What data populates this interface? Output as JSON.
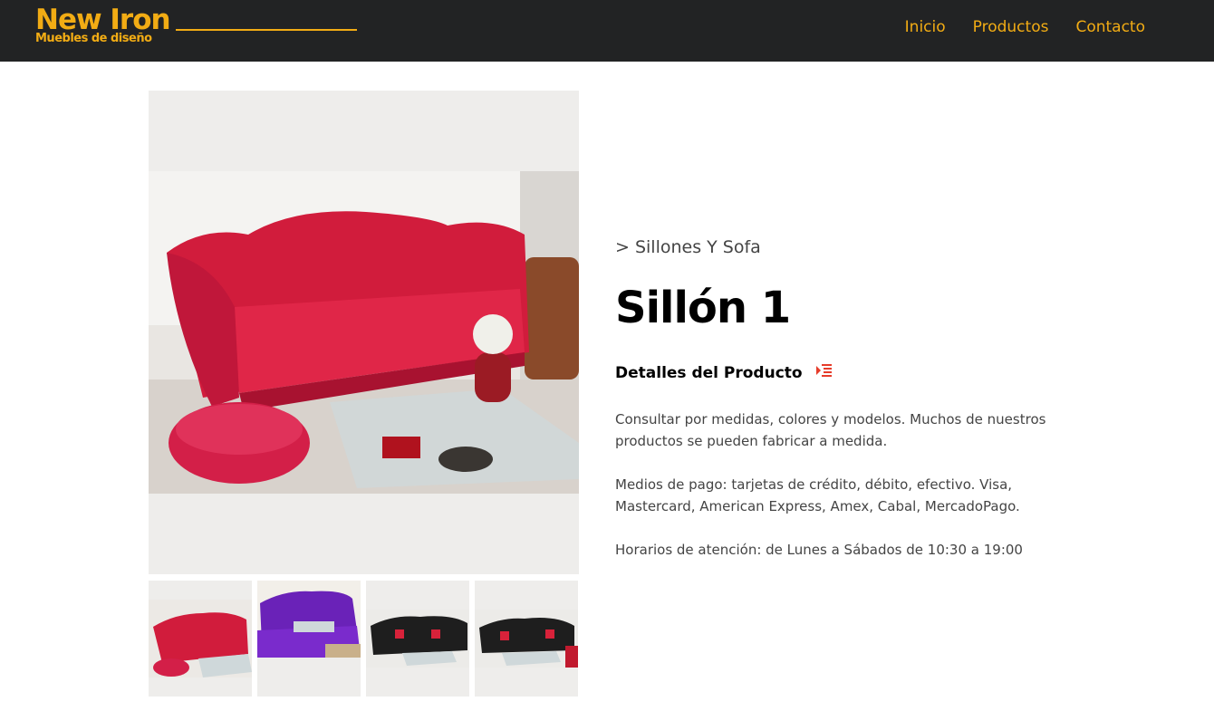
{
  "header": {
    "brand": "New Iron",
    "tagline": "Muebles de diseño",
    "nav": [
      "Inicio",
      "Productos",
      "Contacto"
    ],
    "accent_color": "#f2ac14",
    "background_color": "#222324"
  },
  "product": {
    "breadcrumb": "> Sillones Y Sofa",
    "title": "Sillón 1",
    "details_heading": "Detalles del Producto",
    "details_icon": "list-indent-icon",
    "description": [
      "Consultar por medidas, colores y modelos. Muchos de nuestros productos se pueden fabricar a medida.",
      "Medios de pago: tarjetas de crédito, débito, efectivo. Visa, Mastercard, American Express, Amex, Cabal, MercadoPago.",
      "Horarios de atención: de Lunes a Sábados de 10:30 a 19:00"
    ],
    "thumbnails": [
      "red-sofa",
      "purple-sofa",
      "black-sofa",
      "black-sofa-alt"
    ]
  }
}
